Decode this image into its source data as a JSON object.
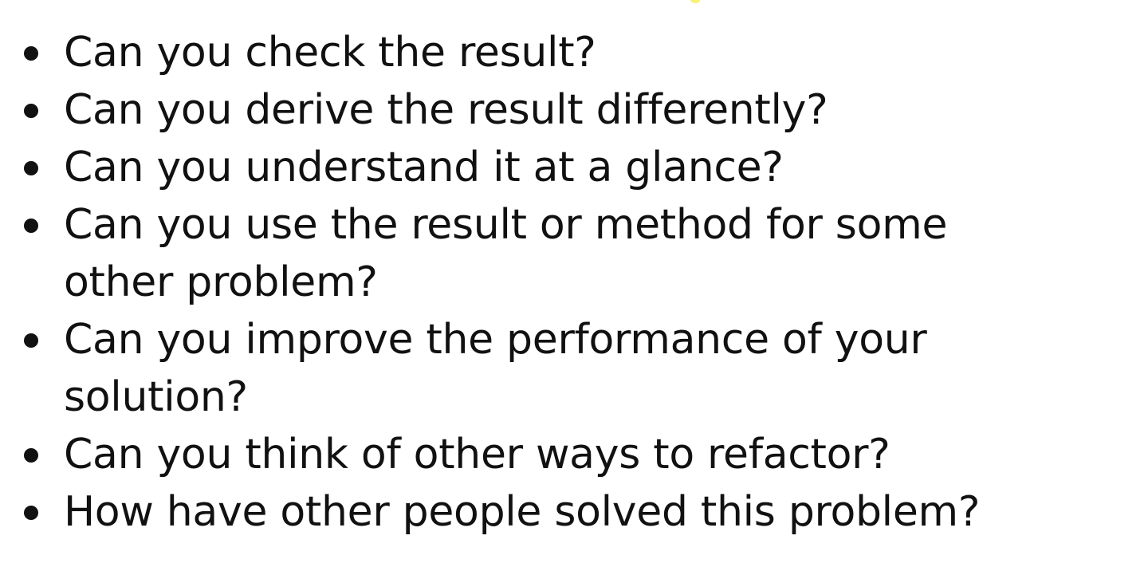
{
  "slide": {
    "bullets": [
      "Can you check the result?",
      "Can you derive the result differently?",
      "Can you understand it at a glance?",
      "Can you use the result or method for some other problem?",
      "Can you improve the performance of your solution?",
      "Can you think of other ways to refactor?",
      "How have other people solved this problem?"
    ]
  },
  "colors": {
    "text": "#111111",
    "background": "#ffffff",
    "accent": "#f2e600"
  }
}
